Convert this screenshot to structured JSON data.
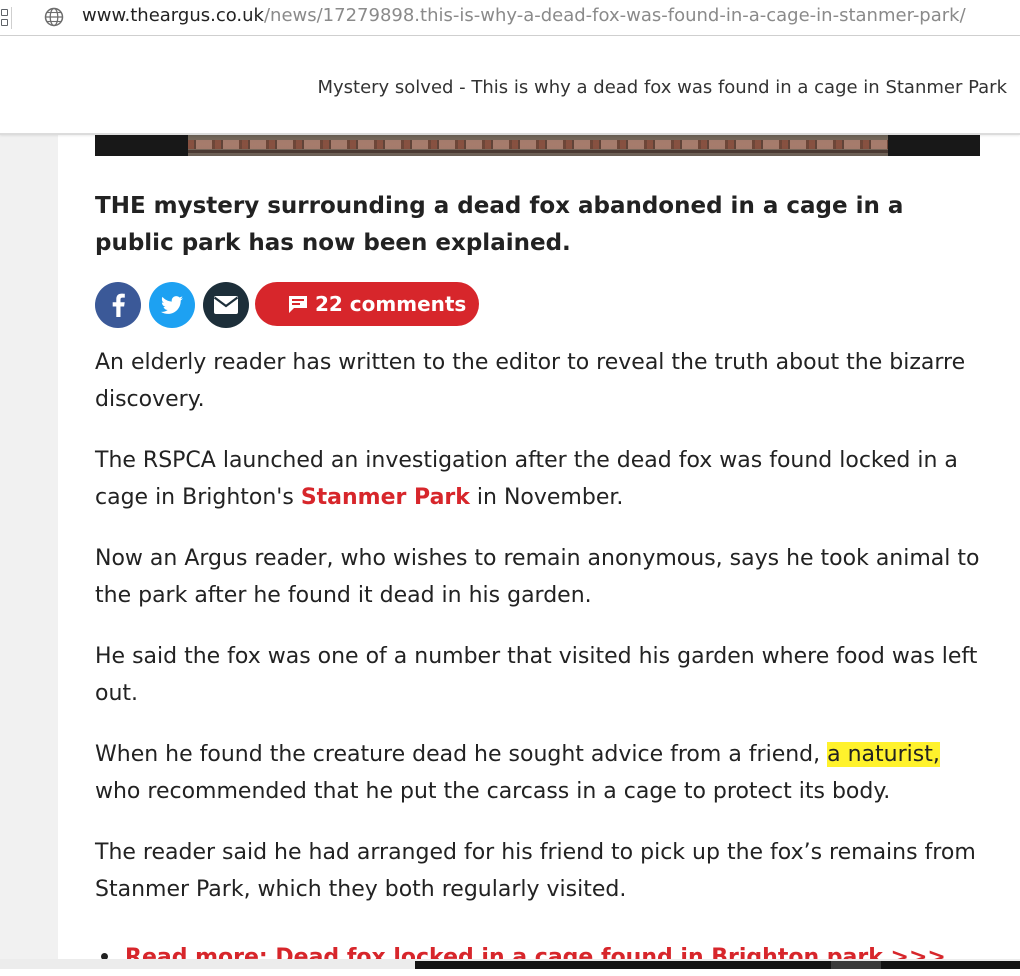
{
  "browser": {
    "url_host": "www.theargus.co.uk",
    "url_path": "/news/17279898.this-is-why-a-dead-fox-was-found-in-a-cage-in-stanmer-park/",
    "icons": [
      "apps-icon",
      "globe-icon"
    ]
  },
  "header": {
    "headline": "Mystery solved - This is why a dead fox was found in a cage in Stanmer Park"
  },
  "article": {
    "lead": "THE mystery surrounding a dead fox abandoned in a cage in a public park has now been explained.",
    "share": {
      "icons": [
        "facebook-icon",
        "twitter-icon",
        "email-icon"
      ],
      "comments_label": "22 comments"
    },
    "p1": "An elderly reader has written to the editor to reveal the truth about the bizarre discovery.",
    "p2_before": "The RSPCA launched an investigation after the dead fox was found locked in a cage in Brighton's ",
    "p2_link": "Stanmer Park",
    "p2_after": " in November.",
    "p3": "Now an Argus reader, who wishes to remain anonymous, says he took animal to the park after he found it dead in his garden.",
    "p4": "He said the fox was one of a number that visited his garden where food was left out.",
    "p5_before": "When he found the creature dead he sought advice from a friend, ",
    "p5_highlight": "a naturist,",
    "p5_after": " who recommended that he put the carcass in a cage to protect its body.",
    "p6": "The reader said he had arranged for his friend to pick up the fox’s remains from Stanmer Park, which they both regularly visited.",
    "read_more": "Read more: Dead fox locked in a cage found in Brighton park >>>"
  },
  "colors": {
    "brand_red": "#d7262b",
    "facebook": "#3b5998",
    "twitter": "#1da1f2",
    "email": "#1d2f3a",
    "highlight": "#fff22c"
  }
}
